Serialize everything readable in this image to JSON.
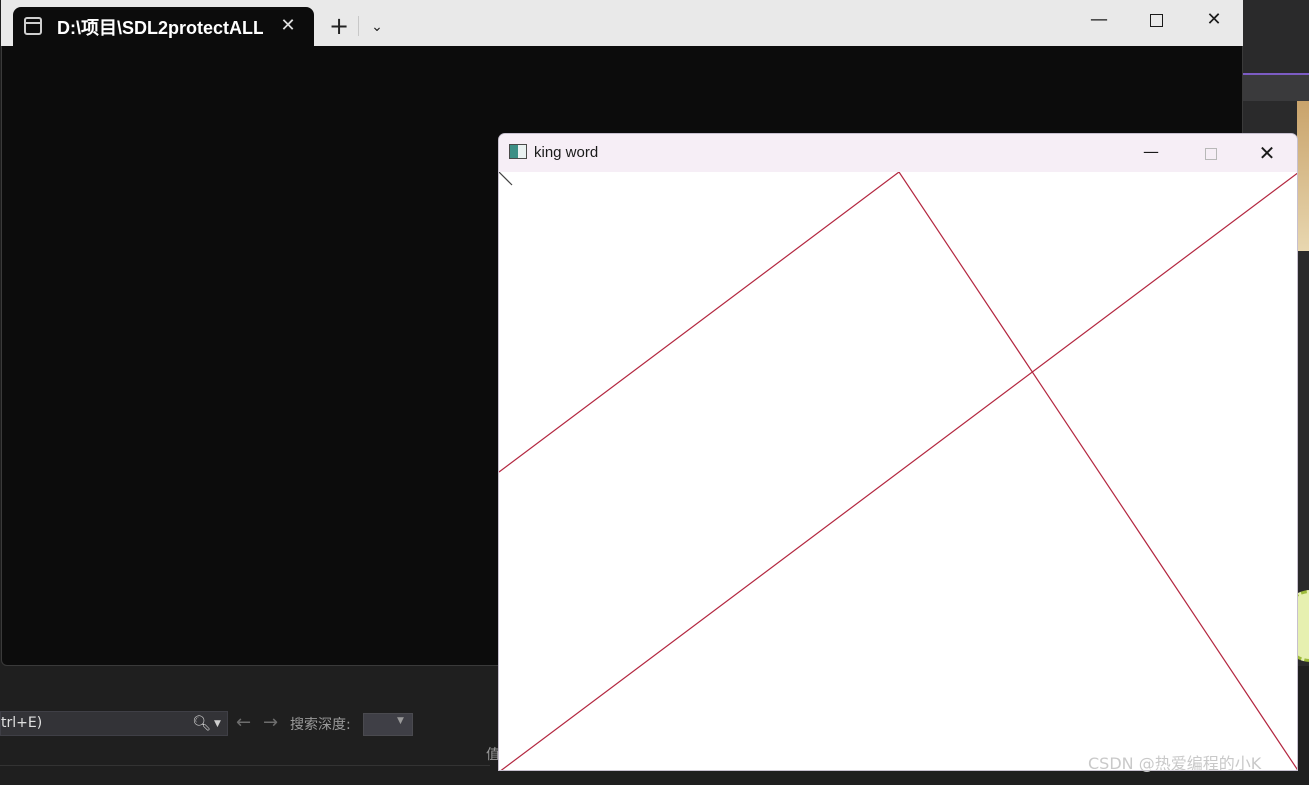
{
  "terminal": {
    "tab_title": "D:\\项目\\SDL2protectALL\\",
    "tab_close_glyph": "✕",
    "new_tab_glyph": "+",
    "dropdown_glyph": "⌄",
    "minimize_glyph": "—",
    "close_glyph": "✕"
  },
  "ide": {
    "tree_row_text": "",
    "search_value": "trl+E)",
    "search_icon": "search-icon",
    "back_glyph": "←",
    "forward_glyph": "→",
    "depth_label": "搜索深度:",
    "value_label": "值"
  },
  "sdl_window": {
    "title": "king word",
    "minimize_glyph": "—",
    "close_glyph": "✕",
    "line_color": "#b3263f",
    "cursor_color": "#444444"
  },
  "watermark": "CSDN @热爱编程的小K",
  "colors": {
    "terminal_bg": "#0c0c0c",
    "titlebar_bg": "#e9e9e9",
    "sdl_titlebar_bg": "#f6eef6",
    "accent_purple": "#7c5cc4"
  }
}
